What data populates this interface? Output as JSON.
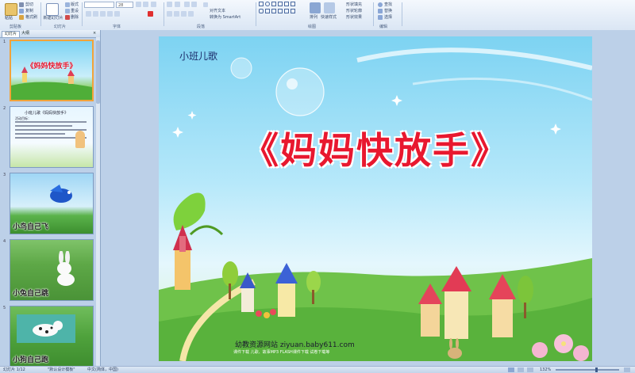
{
  "ribbon": {
    "clipboard": {
      "paste_label": "粘贴",
      "cut_label": "剪切",
      "copy_label": "复制",
      "format_painter_label": "格式刷",
      "group_label": "剪贴板"
    },
    "slides": {
      "new_slide_label": "新建幻灯片",
      "layout_label": "版式",
      "reset_label": "重设",
      "delete_label": "删除",
      "group_label": "幻灯片"
    },
    "font": {
      "size_value": "28",
      "group_label": "字体"
    },
    "paragraph": {
      "align_text_label": "对齐文本",
      "smartart_label": "转换为 SmartArt",
      "group_label": "段落"
    },
    "drawing": {
      "arrange_label": "排列",
      "quick_styles_label": "快速样式",
      "shape_fill_label": "形状填充",
      "shape_outline_label": "形状轮廓",
      "shape_effects_label": "形状效果",
      "group_label": "绘图"
    },
    "editing": {
      "find_label": "查找",
      "replace_label": "替换",
      "select_label": "选择",
      "group_label": "编辑"
    }
  },
  "pane": {
    "tabs": [
      {
        "label": "幻灯片"
      },
      {
        "label": "大纲"
      }
    ],
    "close_label": "×",
    "slides": [
      {
        "num": "1",
        "caption": "《妈妈快放手》"
      },
      {
        "num": "2",
        "caption": "",
        "text_title": "小班儿歌《妈妈快放手》",
        "text_sub": "活动目标："
      },
      {
        "num": "3",
        "caption": "小鸟自己飞"
      },
      {
        "num": "4",
        "caption": "小兔自己跳"
      },
      {
        "num": "5",
        "caption": "小狗自己跑"
      }
    ]
  },
  "slide": {
    "subtitle": "小班儿歌",
    "title": "《妈妈快放手》",
    "footer_line1": "幼教资源网站  ziyuan.baby611.com",
    "footer_line2": "课件下载  儿歌、故事MP3  FLASH课件下载  试卷下载等"
  },
  "status": {
    "slide_counter": "幻灯片 1/12",
    "theme": "\"默认设计模板\"",
    "language": "中文(简体，中国)",
    "zoom": "132%"
  }
}
